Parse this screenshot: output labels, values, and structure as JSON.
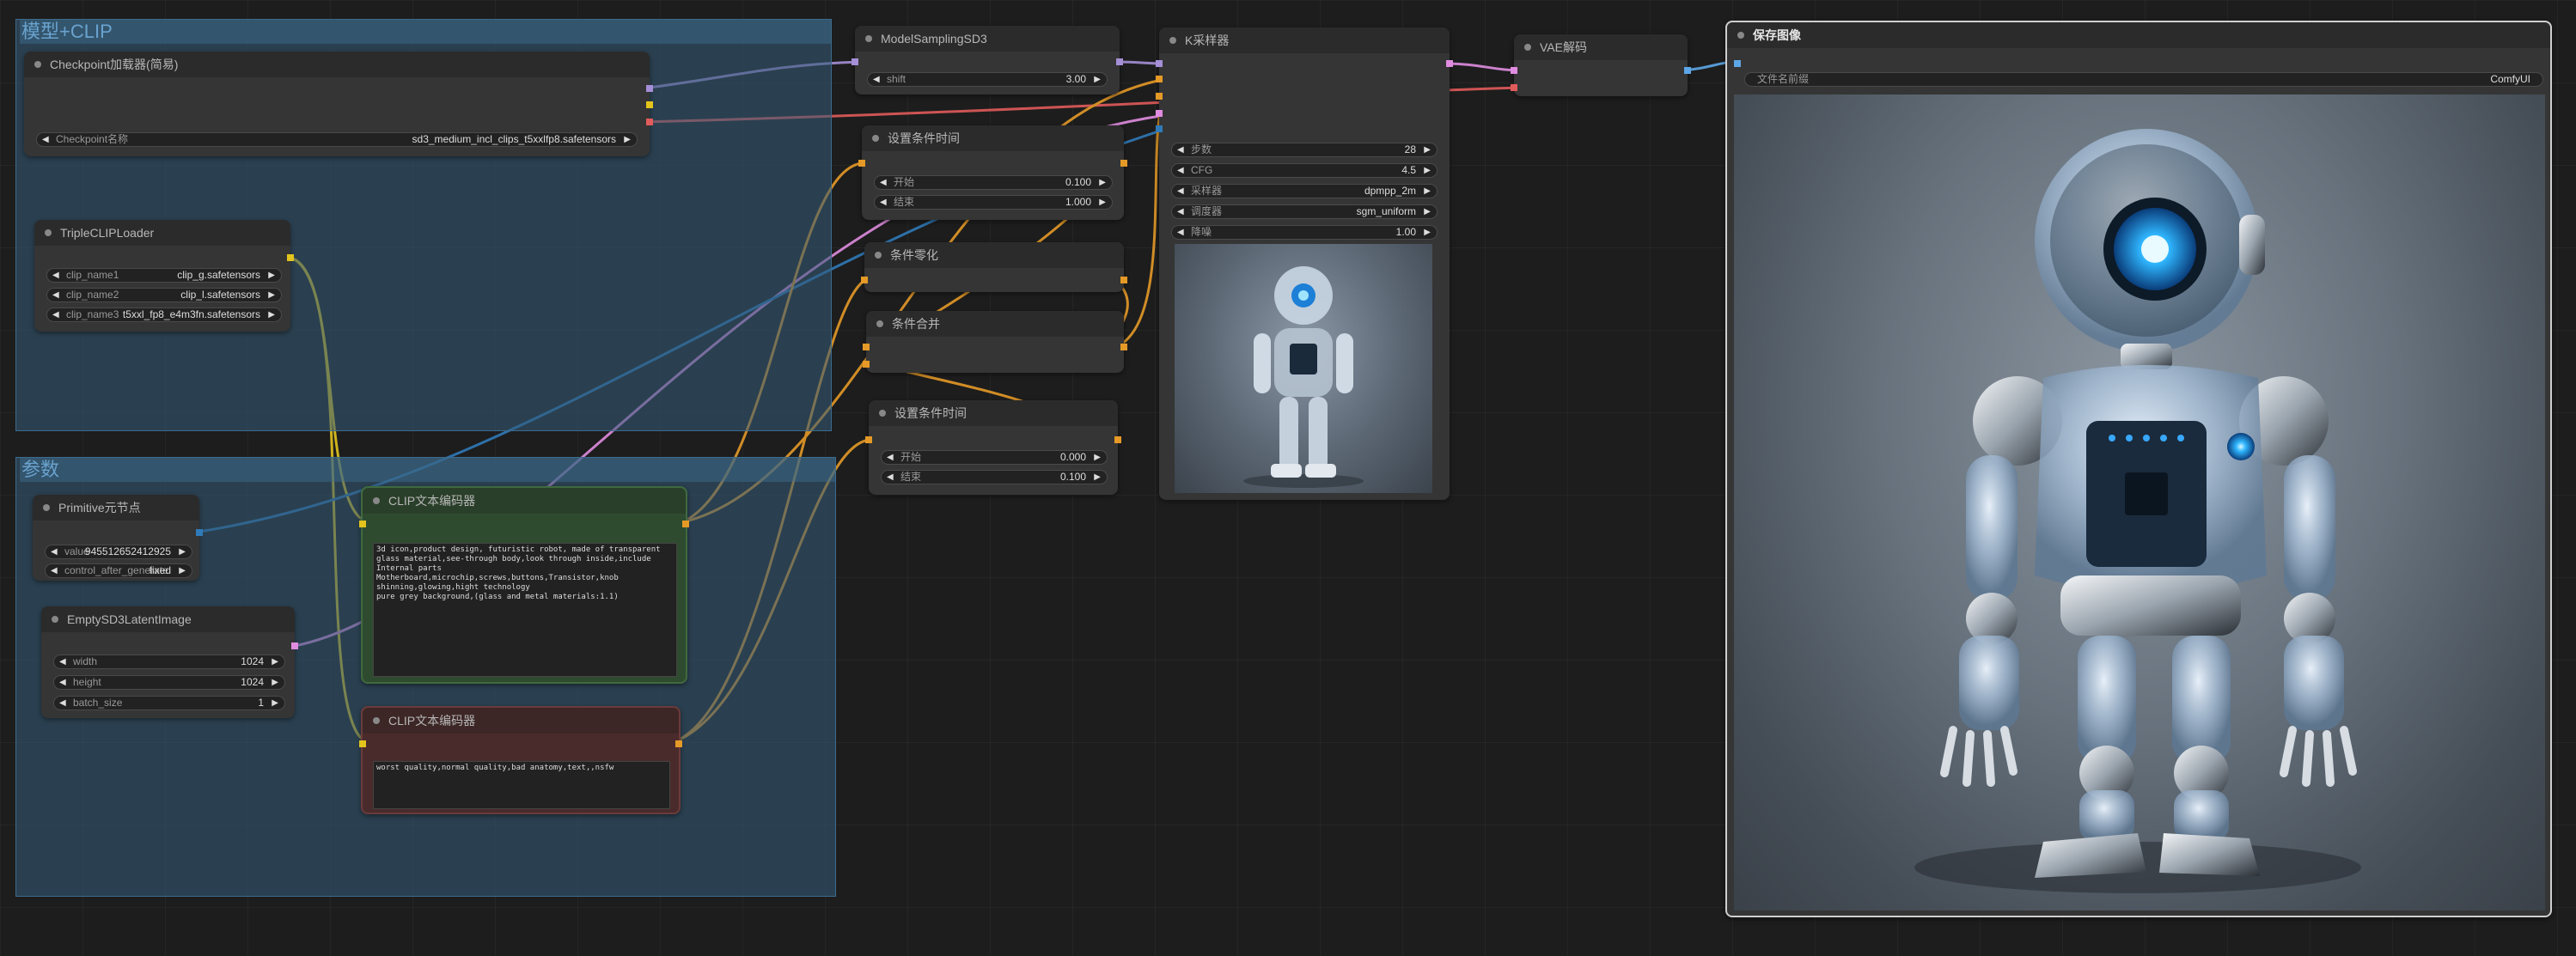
{
  "groups": {
    "model": "模型+CLIP",
    "params": "参数"
  },
  "nodes": {
    "checkpoint": {
      "title": "Checkpoint加载器(简易)",
      "w_label": "Checkpoint名称",
      "w_value": "sd3_medium_incl_clips_t5xxlfp8.safetensors"
    },
    "triple_clip": {
      "title": "TripleCLIPLoader",
      "w1_label": "clip_name1",
      "w1_value": "clip_g.safetensors",
      "w2_label": "clip_name2",
      "w2_value": "clip_l.safetensors",
      "w3_label": "clip_name3",
      "w3_value": "t5xxl_fp8_e4m3fn.safetensors"
    },
    "primitive": {
      "title": "Primitive元节点",
      "w1_label": "value",
      "w1_value": "945512652412925",
      "w2_label": "control_after_generate",
      "w2_value": "fixed"
    },
    "latent": {
      "title": "EmptySD3LatentImage",
      "w1_label": "width",
      "w1_value": "1024",
      "w2_label": "height",
      "w2_value": "1024",
      "w3_label": "batch_size",
      "w3_value": "1"
    },
    "clip_pos": {
      "title": "CLIP文本编码器",
      "text": "3d icon,product design, futuristic robot, made of transparent glass material,see-through body,look through inside,include Internal parts Motherboard,microchip,screws,buttons,Transistor,knob shinning,glowing,hight technology\npure grey background,(glass and metal materials:1.1)"
    },
    "clip_neg": {
      "title": "CLIP文本编码器",
      "text": "worst quality,normal quality,bad anatomy,text,,nsfw"
    },
    "model_sampling": {
      "title": "ModelSamplingSD3",
      "w_label": "shift",
      "w_value": "3.00"
    },
    "cond_time1": {
      "title": "设置条件时间",
      "w1_label": "开始",
      "w1_value": "0.100",
      "w2_label": "结束",
      "w2_value": "1.000"
    },
    "cond_zero": {
      "title": "条件零化"
    },
    "cond_combine": {
      "title": "条件合并"
    },
    "cond_time2": {
      "title": "设置条件时间",
      "w1_label": "开始",
      "w1_value": "0.000",
      "w2_label": "结束",
      "w2_value": "0.100"
    },
    "ksampler": {
      "title": "K采样器",
      "w1_label": "步数",
      "w1_value": "28",
      "w2_label": "CFG",
      "w2_value": "4.5",
      "w3_label": "采样器",
      "w3_value": "dpmpp_2m",
      "w4_label": "调度器",
      "w4_value": "sgm_uniform",
      "w5_label": "降噪",
      "w5_value": "1.00"
    },
    "vae_decode": {
      "title": "VAE解码"
    },
    "save_image": {
      "title": "保存图像",
      "w_label": "文件名前缀",
      "w_value": "ComfyUI"
    }
  },
  "colors": {
    "model_link": "#b39ddb",
    "clip_link": "#ffd500",
    "vae_link": "#ff6e6e",
    "cond_link": "#ffa931",
    "latent_link": "#ff9cf9",
    "image_link": "#64b5f6",
    "int_link": "#4a90d9",
    "green_node": "#2f4b2f",
    "red_node": "#4a2b2b"
  },
  "icons": {
    "arrow_left": "◀",
    "arrow_right": "▶"
  }
}
